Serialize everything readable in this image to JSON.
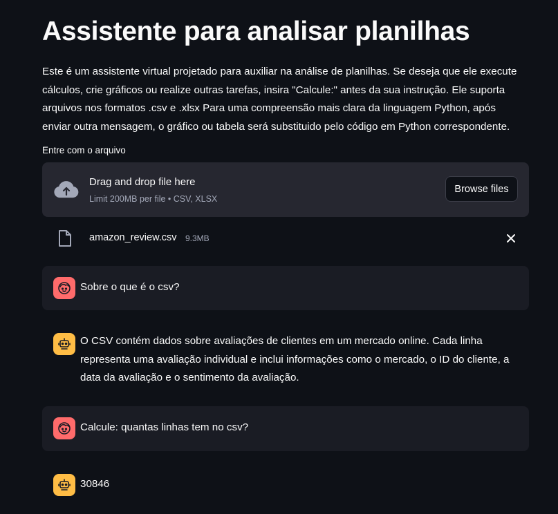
{
  "page": {
    "title": "Assistente para analisar planilhas",
    "description": "Este é um assistente virtual projetado para auxiliar na análise de planilhas. Se deseja que ele execute cálculos, crie gráficos ou realize outras tarefas, insira \"Calcule:\" antes da sua instrução. Ele suporta arquivos nos formatos .csv e .xlsx Para uma compreensão mais clara da linguagem Python, após enviar outra mensagem, o gráfico ou tabela será substituido pelo código em Python correspondente."
  },
  "uploader": {
    "label": "Entre com o arquivo",
    "drop_title": "Drag and drop file here",
    "drop_subtitle": "Limit 200MB per file • CSV, XLSX",
    "browse_label": "Browse files",
    "icon": "cloud-upload-icon",
    "file": {
      "name": "amazon_review.csv",
      "size": "9.3MB",
      "icon": "file-icon",
      "remove_icon": "close-icon"
    }
  },
  "chat": {
    "messages": [
      {
        "role": "user",
        "text": "Sobre o que é o csv?"
      },
      {
        "role": "assistant",
        "text": "O CSV contém dados sobre avaliações de clientes em um mercado online. Cada linha representa uma avaliação individual e inclui informações como o mercado, o ID do cliente, a data da avaliação e o sentimento da avaliação."
      },
      {
        "role": "user",
        "text": "Calcule: quantas linhas tem no csv?"
      },
      {
        "role": "assistant",
        "text": "30846"
      }
    ]
  },
  "colors": {
    "background": "#0e1117",
    "dropzone": "#262730",
    "user_message_bg": "#1a1c24",
    "user_avatar": "#ff6b6b",
    "assistant_avatar": "#ffbd45",
    "muted_text": "#a3a8b8"
  }
}
